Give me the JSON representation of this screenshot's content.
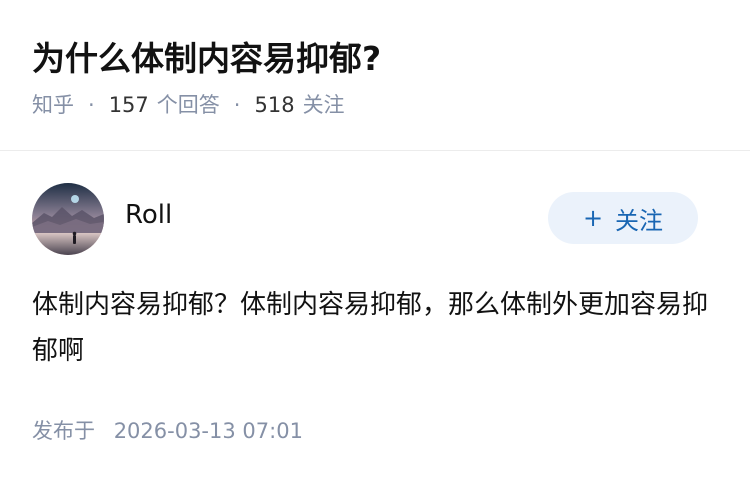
{
  "question": {
    "title": "为什么体制内容易抑郁?",
    "source": "知乎",
    "answer_count": "157",
    "answer_label": "个回答",
    "follower_count": "518",
    "follower_label": "关注",
    "separator": "·"
  },
  "author": {
    "name": "Roll",
    "avatar_icon": "avatar-mountain-landscape"
  },
  "follow_button": {
    "icon": "+",
    "label": "关注"
  },
  "answer": {
    "content": "体制内容易抑郁？体制内容易抑郁，那么体制外更加容易抑郁啊"
  },
  "publish": {
    "label": "发布于",
    "date": "2026-03-13 07:01"
  },
  "colors": {
    "title": "#121212",
    "meta": "#8590a6",
    "accent": "#1966b3",
    "button_bg": "#ebf2fb"
  }
}
